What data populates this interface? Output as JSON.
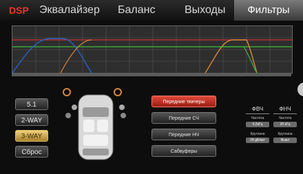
{
  "tabs": {
    "dsp": "DSP",
    "equalizer": "Эквалайзер",
    "balance": "Баланс",
    "outputs": "Выходы",
    "filters": "Фильтры"
  },
  "left_buttons": [
    "5.1",
    "2-WAY",
    "3-WAY",
    "Сброс"
  ],
  "channel_buttons": [
    "Передние твитеры",
    "Передние СЧ",
    "Передние НЧ",
    "Сабвуферы"
  ],
  "filter_panel": {
    "hpf_label": "ФВЧ",
    "lpf_label": "ФНЧ",
    "freq_label": "Частота",
    "slope_label": "Крутизна",
    "hpf_freq": "4.2кГц",
    "lpf_freq": "20 кГц",
    "hpf_slope": "24 дБ/окт",
    "lpf_slope": "Выкл"
  },
  "colors": {
    "active_tab": "#5a5a5a",
    "selected_preset": "#d8b45a",
    "selected_channel": "#c8281c",
    "curve_blue": "#2b63c8",
    "curve_orange": "#d8883a",
    "curve_green": "#3bbf3b",
    "curve_red": "#d03030"
  }
}
